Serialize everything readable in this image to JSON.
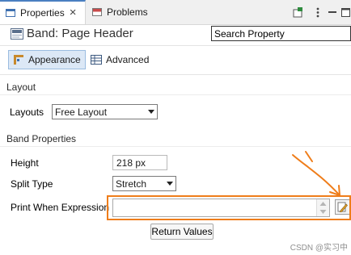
{
  "tabs": [
    {
      "label": "Properties",
      "active": true,
      "close": "×"
    },
    {
      "label": "Problems",
      "active": false
    }
  ],
  "header": {
    "title": "Band: Page Header",
    "search_value": "Search Property"
  },
  "subtabs": [
    {
      "label": "Appearance",
      "selected": true
    },
    {
      "label": "Advanced",
      "selected": false
    }
  ],
  "layout_section": {
    "heading": "Layout",
    "layouts_label": "Layouts",
    "layouts_value": "Free Layout"
  },
  "band_section": {
    "heading": "Band Properties",
    "height_label": "Height",
    "height_value": "218 px",
    "split_type_label": "Split Type",
    "split_type_value": "Stretch",
    "print_when_label": "Print When Expression",
    "print_when_value": ""
  },
  "return_values_label": "Return Values",
  "watermark": "CSDN @实习中",
  "colors": {
    "highlight": "#ef7d1a",
    "selected_subtab_bg": "#dce8f6",
    "active_tab_border": "#4a7fc1"
  },
  "icons": {
    "properties_tab": "properties-icon",
    "problems_tab": "problems-icon",
    "header": "band-icon",
    "appearance": "appearance-icon",
    "advanced": "table-icon",
    "expression_editor": "pencil-icon"
  }
}
